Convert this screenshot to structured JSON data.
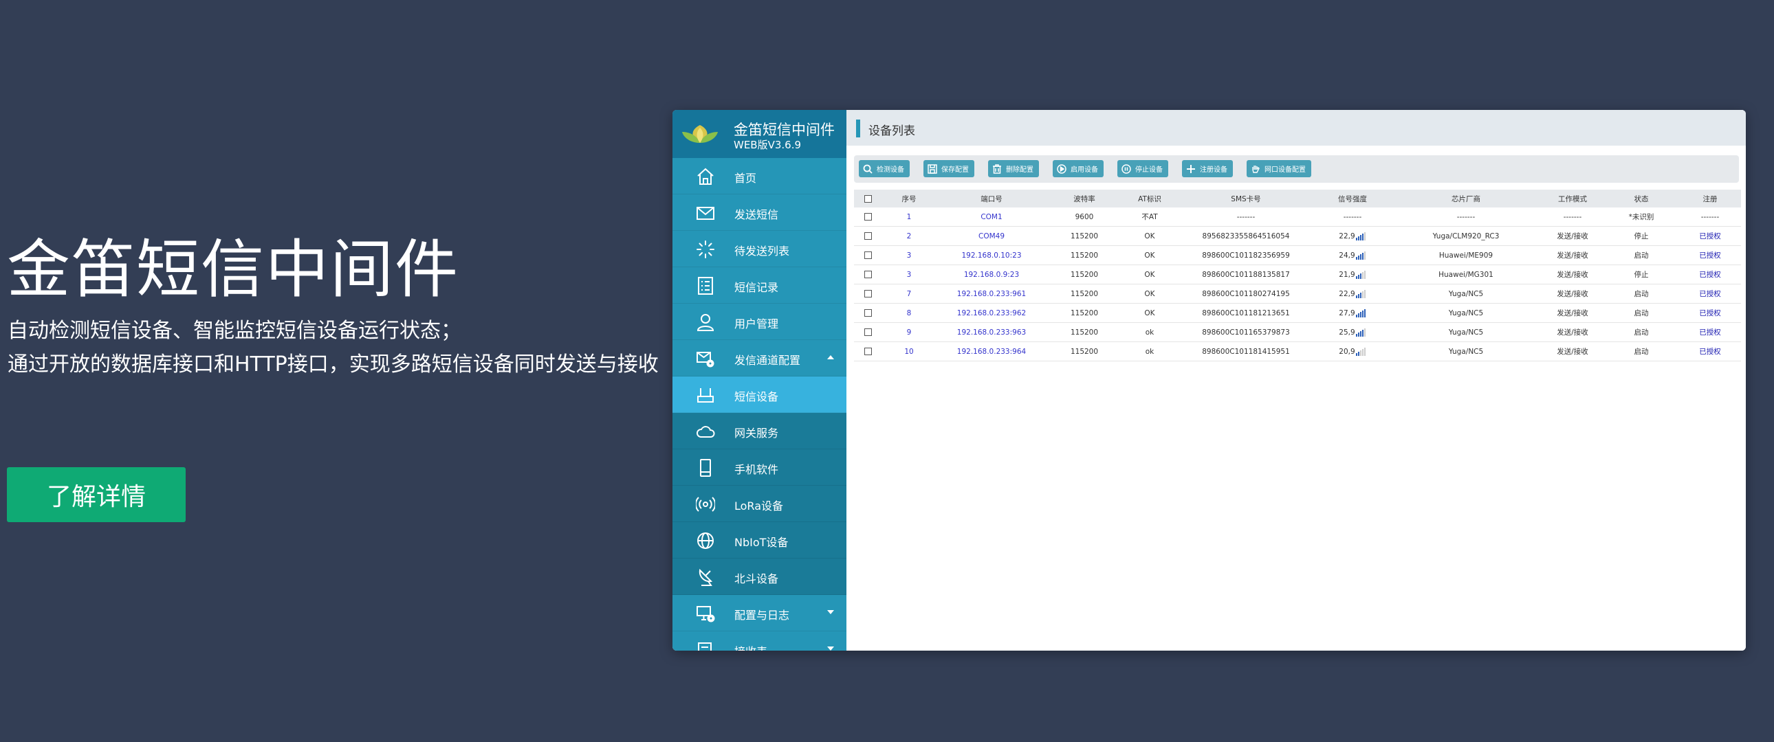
{
  "hero": {
    "title": "金笛短信中间件",
    "line1": "自动检测短信设备、智能监控短信设备运行状态；",
    "line2": "通过开放的数据库接口和HTTP接口，实现多路短信设备同时发送与接收",
    "cta": "了解详情"
  },
  "colors": {
    "background": "#333e55",
    "sidebar": "#2596b7",
    "brand_bar": "#15759a",
    "active_item": "#37b2de",
    "cta": "#0faa74"
  },
  "app": {
    "name": "金笛短信中间件",
    "version": "WEB版V3.6.9"
  },
  "sidebar": {
    "items": [
      {
        "label": "首页",
        "icon": "home-icon"
      },
      {
        "label": "发送短信",
        "icon": "envelope-icon"
      },
      {
        "label": "待发送列表",
        "icon": "loading-icon"
      },
      {
        "label": "短信记录",
        "icon": "list-icon"
      },
      {
        "label": "用户管理",
        "icon": "user-icon"
      },
      {
        "label": "发信通道配置",
        "icon": "mail-gear-icon"
      },
      {
        "label": "短信设备",
        "icon": "modem-icon"
      },
      {
        "label": "网关服务",
        "icon": "cloud-icon"
      },
      {
        "label": "手机软件",
        "icon": "phone-icon"
      },
      {
        "label": "LoRa设备",
        "icon": "signal-icon"
      },
      {
        "label": "NbIoT设备",
        "icon": "globe-icon"
      },
      {
        "label": "北斗设备",
        "icon": "satellite-dish-icon"
      },
      {
        "label": "配置与日志",
        "icon": "monitor-gear-icon"
      },
      {
        "label": "接收表",
        "icon": "table-icon"
      }
    ]
  },
  "main": {
    "title": "设备列表",
    "toolbar": [
      {
        "label": "检测设备",
        "icon": "search-icon"
      },
      {
        "label": "保存配置",
        "icon": "save-icon"
      },
      {
        "label": "删除配置",
        "icon": "trash-icon"
      },
      {
        "label": "启用设备",
        "icon": "play-icon"
      },
      {
        "label": "停止设备",
        "icon": "pause-icon"
      },
      {
        "label": "注册设备",
        "icon": "plus-icon"
      },
      {
        "label": "网口设备配置",
        "icon": "hand-icon"
      }
    ],
    "columns": [
      "序号",
      "端口号",
      "波特率",
      "AT标识",
      "SMS卡号",
      "信号强度",
      "芯片厂商",
      "工作模式",
      "状态",
      "注册"
    ],
    "rows": [
      {
        "no": "1",
        "port": "COM1",
        "baud": "9600",
        "at": "不AT",
        "sms": "-------",
        "signal": "-------",
        "vendor": "-------",
        "mode": "-------",
        "status": "*未识别",
        "reg": "-------"
      },
      {
        "no": "2",
        "port": "COM49",
        "baud": "115200",
        "at": "OK",
        "sms": "8956823355864516054",
        "signal": "22,9",
        "bars": 4,
        "vendor": "Yuga/CLM920_RC3",
        "mode": "发送/接收",
        "status": "停止",
        "reg": "已授权"
      },
      {
        "no": "3",
        "port": "192.168.0.10:23",
        "baud": "115200",
        "at": "OK",
        "sms": "898600C101182356959",
        "signal": "24,9",
        "bars": 4,
        "vendor": "Huawei/ME909",
        "mode": "发送/接收",
        "status": "启动",
        "reg": "已授权"
      },
      {
        "no": "3",
        "port": "192.168.0.9:23",
        "baud": "115200",
        "at": "OK",
        "sms": "898600C101188135817",
        "signal": "21,9",
        "bars": 3,
        "vendor": "Huawei/MG301",
        "mode": "发送/接收",
        "status": "停止",
        "reg": "已授权"
      },
      {
        "no": "7",
        "port": "192.168.0.233:961",
        "baud": "115200",
        "at": "OK",
        "sms": "898600C101180274195",
        "signal": "22,9",
        "bars": 3,
        "vendor": "Yuga/NC5",
        "mode": "发送/接收",
        "status": "启动",
        "reg": "已授权"
      },
      {
        "no": "8",
        "port": "192.168.0.233:962",
        "baud": "115200",
        "at": "OK",
        "sms": "898600C101181213651",
        "signal": "27,9",
        "bars": 5,
        "vendor": "Yuga/NC5",
        "mode": "发送/接收",
        "status": "启动",
        "reg": "已授权"
      },
      {
        "no": "9",
        "port": "192.168.0.233:963",
        "baud": "115200",
        "at": "ok",
        "sms": "898600C101165379873",
        "signal": "25,9",
        "bars": 4,
        "vendor": "Yuga/NC5",
        "mode": "发送/接收",
        "status": "启动",
        "reg": "已授权"
      },
      {
        "no": "10",
        "port": "192.168.0.233:964",
        "baud": "115200",
        "at": "ok",
        "sms": "898600C101181415951",
        "signal": "20,9",
        "bars": 2,
        "vendor": "Yuga/NC5",
        "mode": "发送/接收",
        "status": "启动",
        "reg": "已授权"
      }
    ]
  }
}
